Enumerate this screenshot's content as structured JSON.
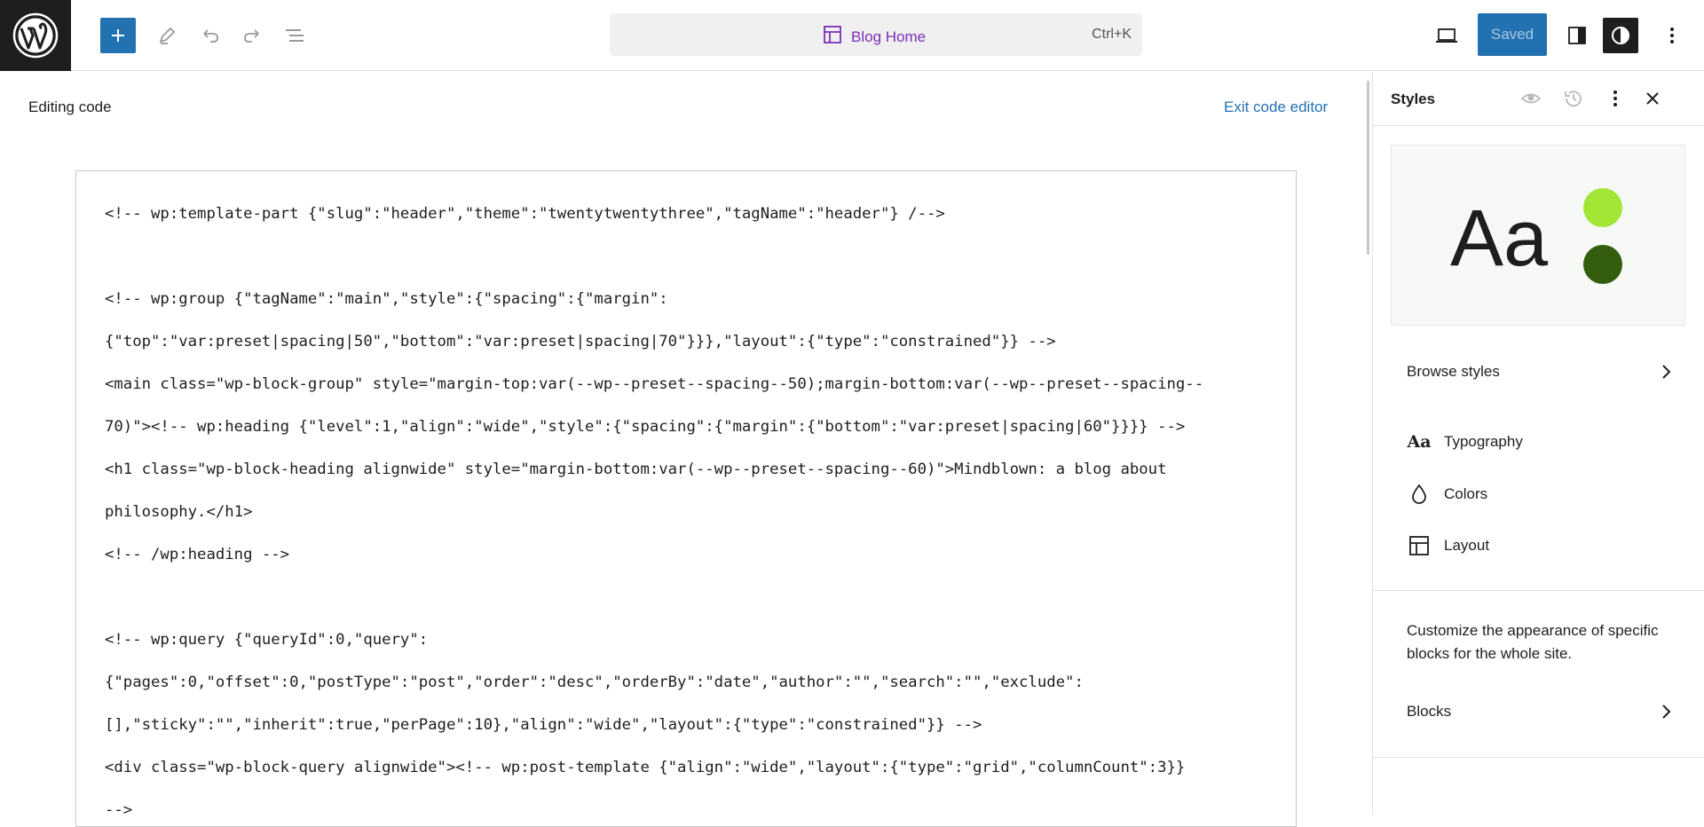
{
  "toolbar": {
    "logo_icon": "wordpress-logo-icon",
    "add_icon": "plus-icon",
    "tools_icon": "pencil-icon",
    "undo_icon": "undo-icon",
    "redo_icon": "redo-icon",
    "list_view_icon": "list-view-icon",
    "command_title": "Blog Home",
    "command_shortcut": "Ctrl+K",
    "view_icon": "laptop-icon",
    "saved_label": "Saved",
    "settings_icon": "sidebar-icon",
    "styles_icon": "half-circle-icon",
    "options_icon": "more-vertical-icon"
  },
  "editor": {
    "editing_label": "Editing code",
    "exit_label": "Exit code editor",
    "code_lines": [
      "<!-- wp:template-part {\"slug\":\"header\",\"theme\":\"twentytwentythree\",\"tagName\":\"header\"} /-->",
      "",
      "<!-- wp:group {\"tagName\":\"main\",\"style\":{\"spacing\":{\"margin\":",
      "{\"top\":\"var:preset|spacing|50\",\"bottom\":\"var:preset|spacing|70\"}}},\"layout\":{\"type\":\"constrained\"}} -->",
      "<main class=\"wp-block-group\" style=\"margin-top:var(--wp--preset--spacing--50);margin-bottom:var(--wp--preset--spacing--",
      "70)\"><!-- wp:heading {\"level\":1,\"align\":\"wide\",\"style\":{\"spacing\":{\"margin\":{\"bottom\":\"var:preset|spacing|60\"}}}} -->",
      "<h1 class=\"wp-block-heading alignwide\" style=\"margin-bottom:var(--wp--preset--spacing--60)\">Mindblown: a blog about",
      "philosophy.</h1>",
      "<!-- /wp:heading -->",
      "",
      "<!-- wp:query {\"queryId\":0,\"query\":",
      "{\"pages\":0,\"offset\":0,\"postType\":\"post\",\"order\":\"desc\",\"orderBy\":\"date\",\"author\":\"\",\"search\":\"\",\"exclude\":",
      "[],\"sticky\":\"\",\"inherit\":true,\"perPage\":10},\"align\":\"wide\",\"layout\":{\"type\":\"constrained\"}} -->",
      "<div class=\"wp-block-query alignwide\"><!-- wp:post-template {\"align\":\"wide\",\"layout\":{\"type\":\"grid\",\"columnCount\":3}}",
      "-->"
    ]
  },
  "sidebar": {
    "title": "Styles",
    "preview": {
      "sample_text": "Aa",
      "color_primary": "#a3e635",
      "color_secondary": "#345d0f"
    },
    "browse_label": "Browse styles",
    "items": [
      {
        "label": "Typography",
        "icon": "typography-icon"
      },
      {
        "label": "Colors",
        "icon": "droplet-icon"
      },
      {
        "label": "Layout",
        "icon": "layout-icon"
      }
    ],
    "description": "Customize the appearance of specific blocks for the whole site.",
    "blocks_label": "Blocks"
  }
}
